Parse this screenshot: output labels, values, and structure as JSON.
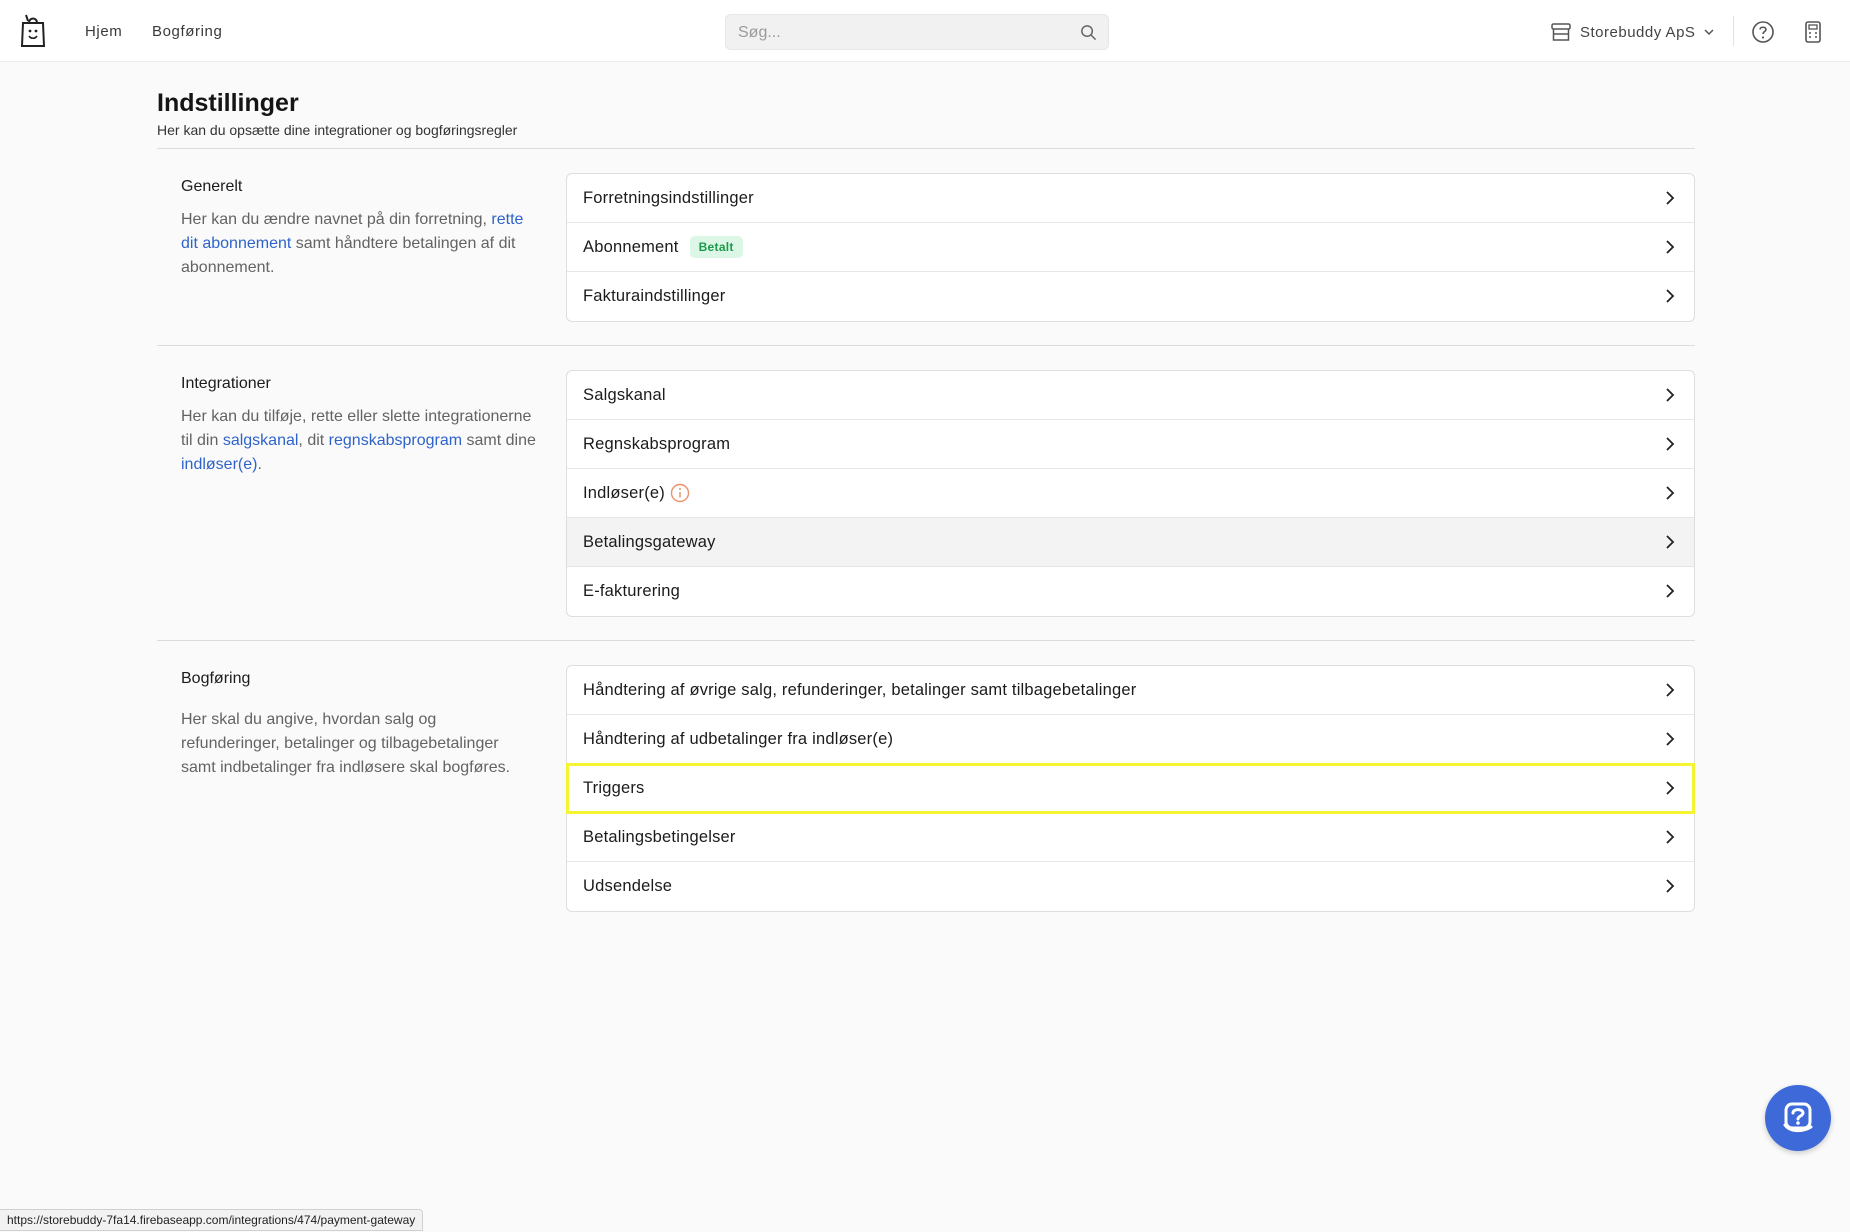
{
  "topbar": {
    "nav": [
      "Hjem",
      "Bogføring"
    ],
    "search_placeholder": "Søg...",
    "company_name": "Storebuddy ApS"
  },
  "page": {
    "title": "Indstillinger",
    "subtitle": "Her kan du opsætte dine integrationer og bogføringsregler"
  },
  "sections": {
    "generelt": {
      "title": "Generelt",
      "desc_1": "Her kan du ændre navnet på din forretning,",
      "link_1": "rette dit abonnement",
      "desc_2": "samt håndtere betalingen af dit abonnement.",
      "rows": [
        "Forretningsindstillinger",
        "Abonnement",
        "Fakturaindstillinger"
      ],
      "badge": "Betalt"
    },
    "integrationer": {
      "title": "Integrationer",
      "desc_1": "Her kan du tilføje, rette eller slette integrationerne til din",
      "link_1": "salgskanal",
      "desc_2": ", dit",
      "link_2": "regnskabsprogram",
      "desc_3": "samt dine",
      "link_3": "indløser(e)",
      "desc_4": ".",
      "rows": [
        "Salgskanal",
        "Regnskabsprogram",
        "Indløser(e)",
        "Betalingsgateway",
        "E-fakturering"
      ]
    },
    "bogforing": {
      "title": "Bogføring",
      "desc": "Her skal du angive, hvordan salg og refunderinger, betalinger og tilbagebetalinger samt indbetalinger fra indløsere skal bogføres.",
      "rows": [
        "Håndtering af øvrige salg, refunderinger, betalinger samt tilbagebetalinger",
        "Håndtering af udbetalinger fra indløser(e)",
        "Triggers",
        "Betalingsbetingelser",
        "Udsendelse"
      ]
    }
  },
  "statusbar": {
    "url": "https://storebuddy-7fa14.firebaseapp.com/integrations/474/payment-gateway"
  },
  "colors": {
    "link": "#2f63c9",
    "badge_bg": "#dcf7e5",
    "badge_text": "#1c9a4c",
    "highlight": "#f4f431",
    "chat_button": "#3d69d9",
    "info_icon": "#e8926a"
  },
  "icons": {
    "logo": "shopping-bag-logo-icon",
    "search": "search-icon",
    "store": "store-icon",
    "help": "question-circle-icon",
    "apps": "calculator-icon",
    "row": "chevron-right-icon",
    "info": "info-circle-icon",
    "chat": "chat-help-icon"
  }
}
